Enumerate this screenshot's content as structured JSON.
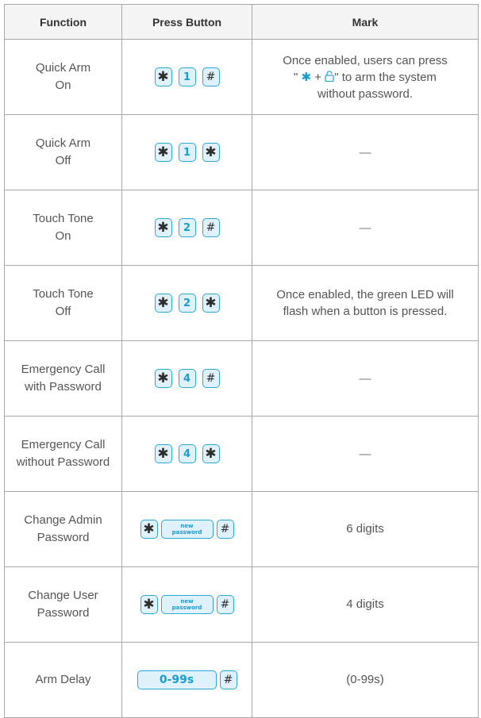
{
  "header": {
    "function": "Function",
    "press_button": "Press Button",
    "mark": "Mark"
  },
  "rows": [
    {
      "function": [
        "Quick Arm",
        "On"
      ],
      "keys": [
        "*",
        "1",
        "#"
      ],
      "mark_parts": {
        "before": "Once enabled, users can press",
        "quote_open": "\"",
        "plus": "+",
        "quote_close": "\" to arm the system",
        "after": "without password."
      }
    },
    {
      "function": [
        "Quick Arm",
        "Off"
      ],
      "keys": [
        "*",
        "1",
        "*"
      ],
      "mark": "—"
    },
    {
      "function": [
        "Touch Tone",
        "On"
      ],
      "keys": [
        "*",
        "2",
        "#"
      ],
      "mark": "—"
    },
    {
      "function": [
        "Touch Tone",
        "Off"
      ],
      "keys": [
        "*",
        "2",
        "*"
      ],
      "mark": [
        "Once enabled, the green LED will",
        "flash when a button is pressed."
      ]
    },
    {
      "function": [
        "Emergency Call",
        "with Password"
      ],
      "keys": [
        "*",
        "4",
        "#"
      ],
      "mark": "—"
    },
    {
      "function": [
        "Emergency Call",
        "without Password"
      ],
      "keys": [
        "*",
        "4",
        "*"
      ],
      "mark": "—"
    },
    {
      "function": [
        "Change Admin",
        "Password"
      ],
      "keys": [
        "*",
        "new password",
        "#"
      ],
      "new_key": [
        "new",
        "password"
      ],
      "mark": "6 digits"
    },
    {
      "function": [
        "Change User",
        "Password"
      ],
      "keys": [
        "*",
        "new password",
        "#"
      ],
      "new_key": [
        "new",
        "password"
      ],
      "mark": "4 digits"
    },
    {
      "function": [
        "Arm Delay"
      ],
      "keys": [
        "0-99s",
        "#"
      ],
      "mark": "(0-99s)"
    }
  ],
  "colors": {
    "accent": "#29a8d6",
    "key_fill": "#dff2fb",
    "border": "#a8a8a8",
    "header_bg": "#f4f4f4"
  }
}
